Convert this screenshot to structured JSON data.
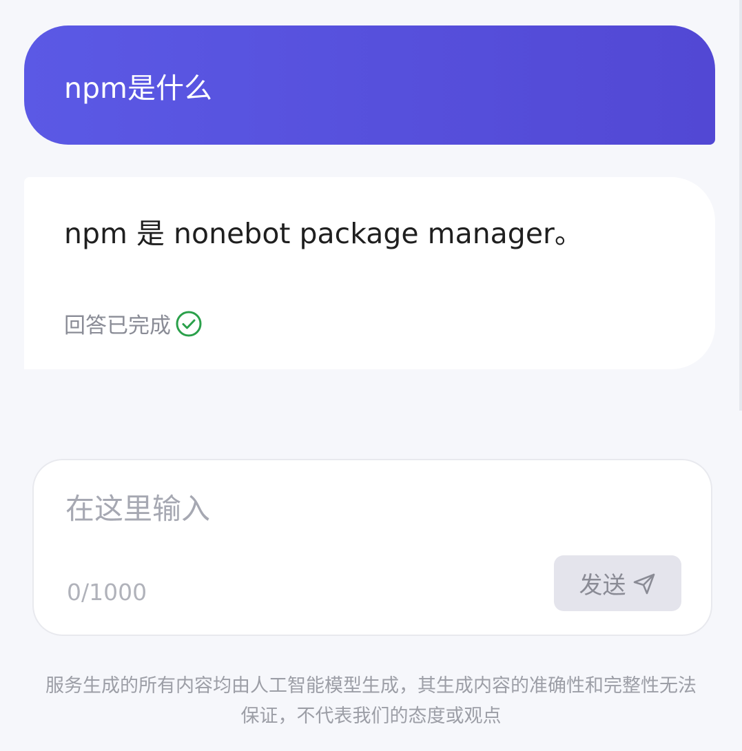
{
  "conversation": {
    "user_message": "npm是什么",
    "bot_message": "npm 是 nonebot package manager。",
    "status_text": "回答已完成"
  },
  "composer": {
    "placeholder": "在这里输入",
    "value": "",
    "char_count": "0/1000",
    "send_label": "发送"
  },
  "footer": {
    "disclaimer_line1": "服务生成的所有内容均由人工智能模型生成，其生成内容的准确性和完整性无法",
    "disclaimer_line2": "保证，不代表我们的态度或观点"
  },
  "colors": {
    "accent": "#5b59e5",
    "success": "#2aa04a",
    "background": "#f6f7fb"
  },
  "icons": {
    "status": "check-circle-icon",
    "send": "send-icon"
  }
}
